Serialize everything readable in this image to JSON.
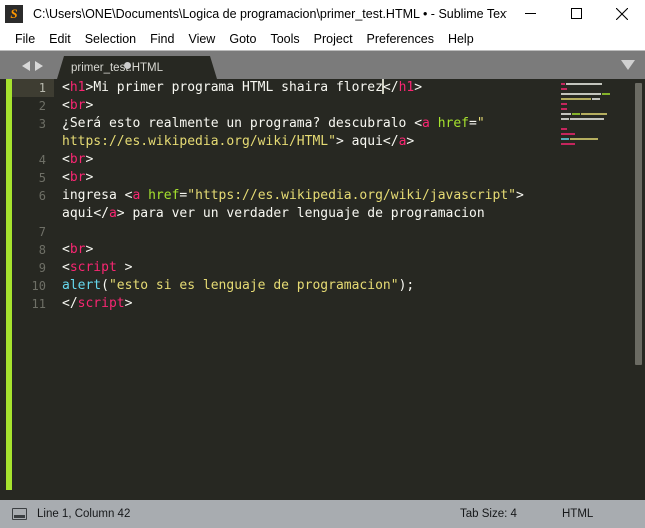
{
  "window": {
    "title": "C:\\Users\\ONE\\Documents\\Logica de programacion\\primer_test.HTML • - Sublime Text ...",
    "logo_glyph": "S",
    "minimize_label": "Minimize",
    "maximize_label": "Maximize",
    "close_label": "Close"
  },
  "menubar": {
    "items": [
      {
        "label": "File"
      },
      {
        "label": "Edit"
      },
      {
        "label": "Selection"
      },
      {
        "label": "Find"
      },
      {
        "label": "View"
      },
      {
        "label": "Goto"
      },
      {
        "label": "Tools"
      },
      {
        "label": "Project"
      },
      {
        "label": "Preferences"
      },
      {
        "label": "Help"
      }
    ]
  },
  "tabbar": {
    "tab_label": "primer_test.HTML",
    "dirty_indicator": "modified-dot",
    "nav_back_icon": "arrow-left-icon",
    "nav_forward_icon": "arrow-right-icon",
    "overflow_icon": "chevron-down-icon"
  },
  "editor": {
    "gutter": [
      "1",
      "2",
      "3",
      "",
      "4",
      "5",
      "6",
      "",
      "7",
      "8",
      "9",
      "10",
      "11"
    ],
    "active_line_index": 0,
    "lines": [
      {
        "gutter": "1",
        "active": true,
        "tokens": [
          {
            "c": "t-punct",
            "s": "<"
          },
          {
            "c": "t-tag",
            "s": "h1"
          },
          {
            "c": "t-punct",
            "s": ">"
          },
          {
            "c": "t-text",
            "s": "Mi primer programa HTML shaira florez"
          },
          {
            "c": "cursor",
            "s": ""
          },
          {
            "c": "t-punct",
            "s": "</"
          },
          {
            "c": "t-tag",
            "s": "h1"
          },
          {
            "c": "t-punct",
            "s": ">"
          }
        ]
      },
      {
        "gutter": "2",
        "active": false,
        "tokens": [
          {
            "c": "t-punct",
            "s": "<"
          },
          {
            "c": "t-tag",
            "s": "br"
          },
          {
            "c": "t-punct",
            "s": ">"
          }
        ]
      },
      {
        "gutter": "3",
        "active": false,
        "tokens": [
          {
            "c": "t-text",
            "s": "¿Será esto realmente un programa? descubralo "
          },
          {
            "c": "t-punct",
            "s": "<"
          },
          {
            "c": "t-tag",
            "s": "a"
          },
          {
            "c": "t-text",
            "s": " "
          },
          {
            "c": "t-attr",
            "s": "href"
          },
          {
            "c": "t-punct",
            "s": "="
          },
          {
            "c": "t-string",
            "s": "\""
          }
        ]
      },
      {
        "gutter": "",
        "active": false,
        "tokens": [
          {
            "c": "t-string",
            "s": "https://es.wikipedia.org/wiki/HTML\""
          },
          {
            "c": "t-punct",
            "s": ">"
          },
          {
            "c": "t-text",
            "s": " aqui"
          },
          {
            "c": "t-punct",
            "s": "</"
          },
          {
            "c": "t-tag",
            "s": "a"
          },
          {
            "c": "t-punct",
            "s": ">"
          }
        ]
      },
      {
        "gutter": "4",
        "active": false,
        "tokens": [
          {
            "c": "t-punct",
            "s": "<"
          },
          {
            "c": "t-tag",
            "s": "br"
          },
          {
            "c": "t-punct",
            "s": ">"
          }
        ]
      },
      {
        "gutter": "5",
        "active": false,
        "tokens": [
          {
            "c": "t-punct",
            "s": "<"
          },
          {
            "c": "t-tag",
            "s": "br"
          },
          {
            "c": "t-punct",
            "s": ">"
          }
        ]
      },
      {
        "gutter": "6",
        "active": false,
        "tokens": [
          {
            "c": "t-text",
            "s": "ingresa "
          },
          {
            "c": "t-punct",
            "s": "<"
          },
          {
            "c": "t-tag",
            "s": "a"
          },
          {
            "c": "t-text",
            "s": " "
          },
          {
            "c": "t-attr",
            "s": "href"
          },
          {
            "c": "t-punct",
            "s": "="
          },
          {
            "c": "t-string",
            "s": "\"https://es.wikipedia.org/wiki/javascript\""
          },
          {
            "c": "t-punct",
            "s": ">"
          }
        ]
      },
      {
        "gutter": "",
        "active": false,
        "tokens": [
          {
            "c": "t-text",
            "s": "aqui"
          },
          {
            "c": "t-punct",
            "s": "</"
          },
          {
            "c": "t-tag",
            "s": "a"
          },
          {
            "c": "t-punct",
            "s": ">"
          },
          {
            "c": "t-text",
            "s": " para ver un verdader lenguaje de programacion"
          }
        ]
      },
      {
        "gutter": "7",
        "active": false,
        "tokens": []
      },
      {
        "gutter": "8",
        "active": false,
        "tokens": [
          {
            "c": "t-punct",
            "s": "<"
          },
          {
            "c": "t-tag",
            "s": "br"
          },
          {
            "c": "t-punct",
            "s": ">"
          }
        ]
      },
      {
        "gutter": "9",
        "active": false,
        "tokens": [
          {
            "c": "t-punct",
            "s": "<"
          },
          {
            "c": "t-tag",
            "s": "script"
          },
          {
            "c": "t-text",
            "s": " "
          },
          {
            "c": "t-punct",
            "s": ">"
          }
        ]
      },
      {
        "gutter": "10",
        "active": false,
        "tokens": [
          {
            "c": "t-fn",
            "s": "alert"
          },
          {
            "c": "t-punct",
            "s": "("
          },
          {
            "c": "t-string",
            "s": "\"esto si es lenguaje de programacion\""
          },
          {
            "c": "t-punct",
            "s": ");"
          }
        ]
      },
      {
        "gutter": "11",
        "active": false,
        "tokens": [
          {
            "c": "t-punct",
            "s": "</"
          },
          {
            "c": "t-tag",
            "s": "script"
          },
          {
            "c": "t-punct",
            "s": ">"
          }
        ]
      }
    ],
    "minimap": [
      [
        [
          "#f92672",
          4
        ],
        [
          "#f8f8f2",
          36
        ]
      ],
      [
        [
          "#f92672",
          6
        ]
      ],
      [
        [
          "#f8f8f2",
          40
        ],
        [
          "#a6e22e",
          8
        ]
      ],
      [
        [
          "#e6db74",
          30
        ],
        [
          "#f8f8f2",
          8
        ]
      ],
      [
        [
          "#f92672",
          6
        ]
      ],
      [
        [
          "#f92672",
          6
        ]
      ],
      [
        [
          "#f8f8f2",
          10
        ],
        [
          "#a6e22e",
          8
        ],
        [
          "#e6db74",
          26
        ]
      ],
      [
        [
          "#f8f8f2",
          8
        ],
        [
          "#f8f8f2",
          34
        ]
      ],
      [],
      [
        [
          "#f92672",
          6
        ]
      ],
      [
        [
          "#f92672",
          14
        ]
      ],
      [
        [
          "#66d9ef",
          8
        ],
        [
          "#e6db74",
          28
        ]
      ],
      [
        [
          "#f92672",
          14
        ]
      ]
    ]
  },
  "statusbar": {
    "panel_icon": "panel-toggle-icon",
    "position": "Line 1, Column 42",
    "tab_size": "Tab Size: 4",
    "syntax": "HTML"
  },
  "colors": {
    "accent_green": "#a6e22e",
    "editor_bg": "#272822",
    "tag_pink": "#f92672",
    "string_yellow": "#e6db74",
    "fn_cyan": "#66d9ef",
    "logo_orange": "#ff9800"
  }
}
